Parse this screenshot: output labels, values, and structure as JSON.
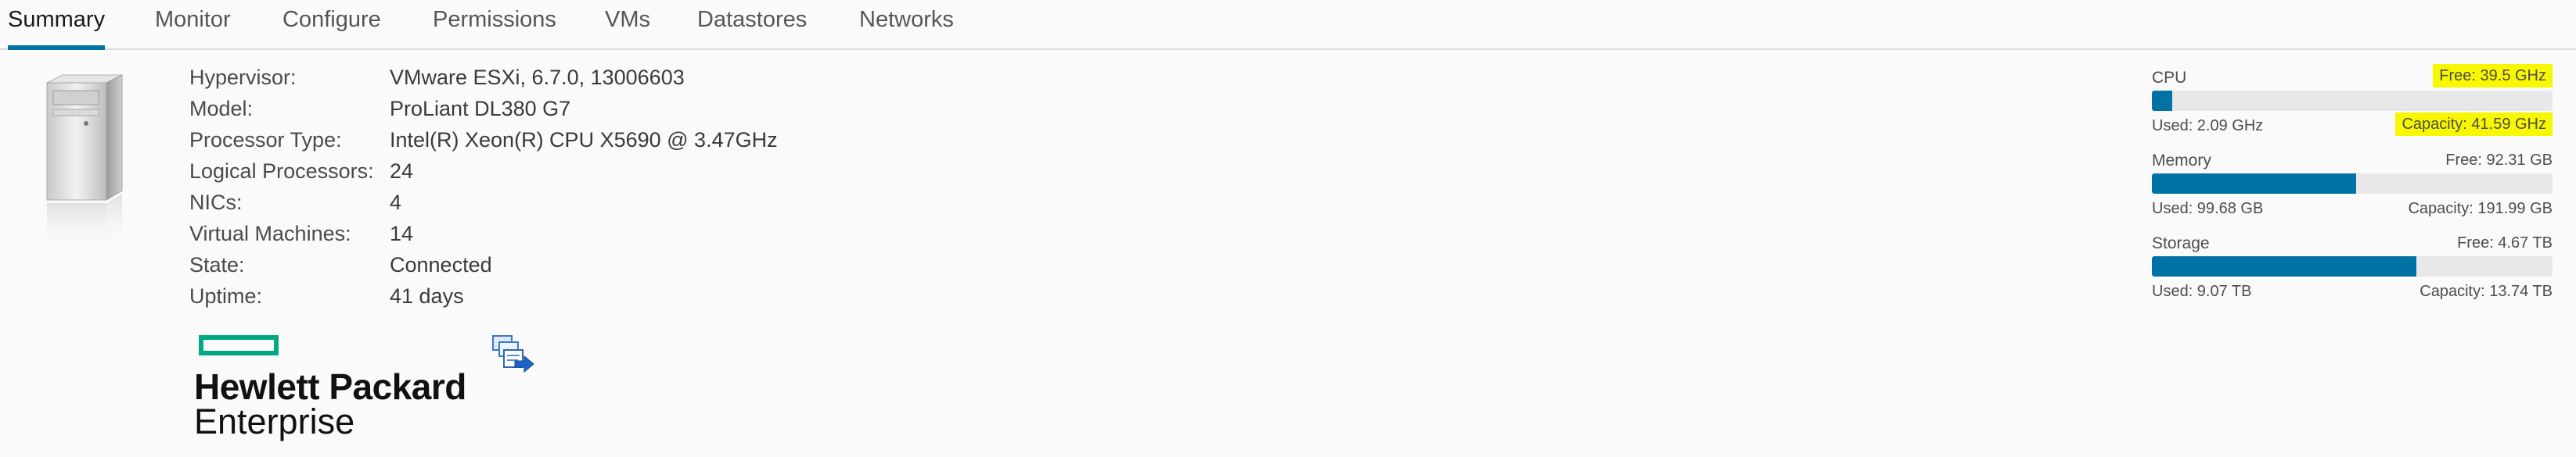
{
  "tabs": [
    {
      "label": "Summary",
      "active": true
    },
    {
      "label": "Monitor"
    },
    {
      "label": "Configure"
    },
    {
      "label": "Permissions"
    },
    {
      "label": "VMs"
    },
    {
      "label": "Datastores"
    },
    {
      "label": "Networks"
    }
  ],
  "host": {
    "properties": [
      {
        "label": "Hypervisor:",
        "value": "VMware ESXi, 6.7.0, 13006603"
      },
      {
        "label": "Model:",
        "value": "ProLiant DL380 G7"
      },
      {
        "label": "Processor Type:",
        "value": "Intel(R) Xeon(R) CPU X5690 @ 3.47GHz"
      },
      {
        "label": "Logical Processors:",
        "value": "24"
      },
      {
        "label": "NICs:",
        "value": "4"
      },
      {
        "label": "Virtual Machines:",
        "value": "14"
      },
      {
        "label": "State:",
        "value": "Connected"
      },
      {
        "label": "Uptime:",
        "value": "41 days"
      }
    ],
    "vendor_logo": {
      "line1": "Hewlett Packard",
      "line2": "Enterprise"
    }
  },
  "resources": [
    {
      "name": "CPU",
      "free": "Free: 39.5 GHz",
      "used": "Used: 2.09 GHz",
      "capacity": "Capacity: 41.59 GHz",
      "used_fraction": 0.05
    },
    {
      "name": "Memory",
      "free": "Free: 92.31 GB",
      "used": "Used: 99.68 GB",
      "capacity": "Capacity: 191.99 GB",
      "used_fraction": 0.51
    },
    {
      "name": "Storage",
      "free": "Free: 4.67 TB",
      "used": "Used: 9.07 TB",
      "capacity": "Capacity: 13.74 TB",
      "used_fraction": 0.66
    }
  ],
  "colors": {
    "accent": "#0072a3",
    "hpe_green": "#01a982",
    "highlight": "#f7f700"
  },
  "icons": [
    "server-icon",
    "export-icon"
  ]
}
